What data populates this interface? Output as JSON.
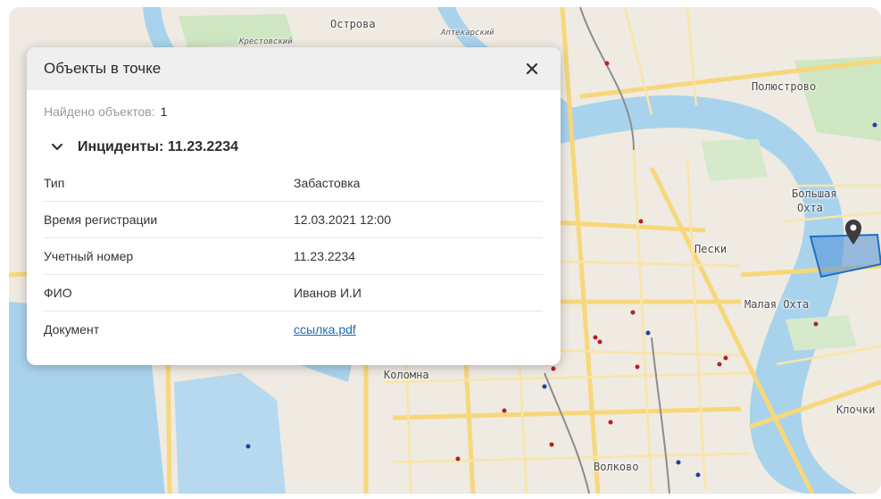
{
  "map": {
    "labels": {
      "ostrova": "Острова",
      "krestovsky": "Крестовский",
      "aptekarsky": "Аптекарский",
      "polyustrovo": "Полюстрово",
      "bolshaya": "Большая",
      "okhta": "Охта",
      "peski": "Пески",
      "malaya_okhta": "Малая Охта",
      "kolomna": "Коломна",
      "klochki": "Клочки",
      "volkovo": "Волково"
    },
    "colors": {
      "water": "#a9d3ec",
      "land": "#efeae2",
      "park": "#cfe6c2",
      "road": "#f7d77a",
      "polygon": "#1f6fbf"
    },
    "marker_icon": "map-pin-icon"
  },
  "popup": {
    "title": "Объекты в точке",
    "close_icon": "close-icon",
    "found_label": "Найдено объектов:",
    "found_count": "1",
    "group_icon": "chevron-down-icon",
    "group_title": "Инциденты: 11.23.2234",
    "rows": [
      {
        "key": "Тип",
        "value": "Забастовка"
      },
      {
        "key": "Время регистрации",
        "value": "12.03.2021 12:00"
      },
      {
        "key": "Учетный номер",
        "value": "11.23.2234"
      },
      {
        "key": "ФИО",
        "value": "Иванов И.И"
      },
      {
        "key": "Документ",
        "value": "ссылка.pdf"
      }
    ]
  }
}
